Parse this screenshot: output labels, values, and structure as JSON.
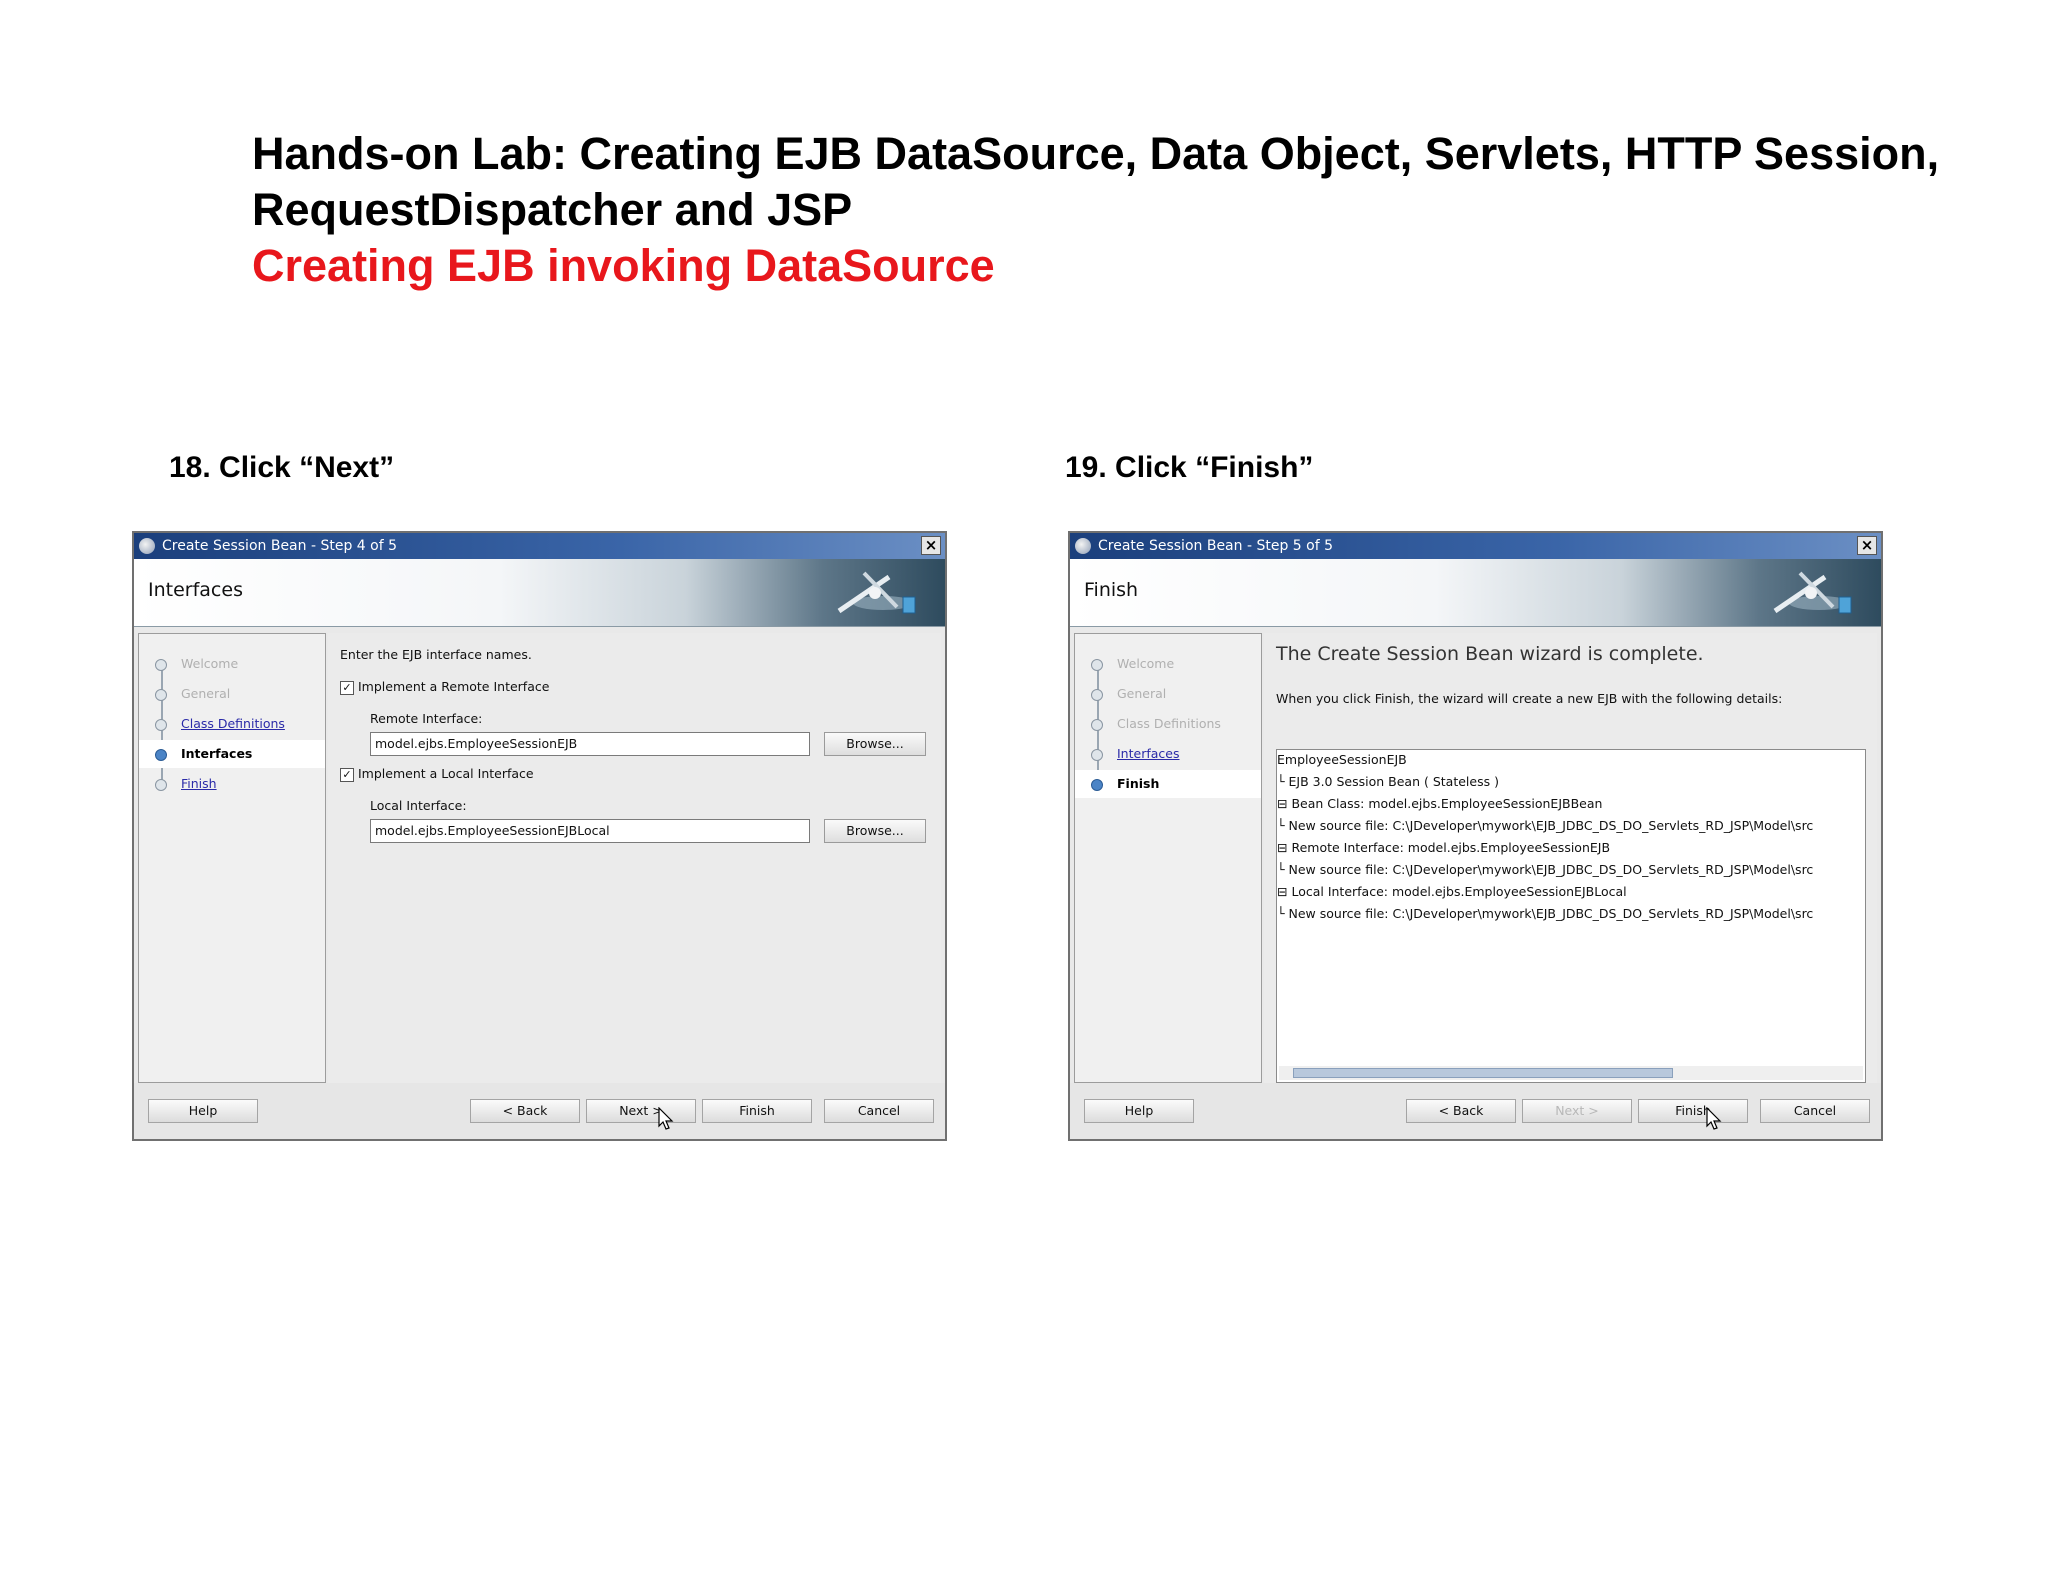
{
  "title": "Hands-on Lab: Creating EJB DataSource, Data Object, Servlets, HTTP Session, RequestDispatcher and JSP",
  "subtitle": "Creating EJB invoking DataSource",
  "steps": [
    {
      "caption": "18. Click “Next”",
      "dialog": {
        "window_title": "Create Session Bean - Step 4 of 5",
        "close_label": "×",
        "page_heading": "Interfaces",
        "nav": [
          {
            "label": "Welcome",
            "state": "disabled"
          },
          {
            "label": "General",
            "state": "disabled"
          },
          {
            "label": "Class Definitions",
            "state": "link"
          },
          {
            "label": "Interfaces",
            "state": "current"
          },
          {
            "label": "Finish",
            "state": "link"
          }
        ],
        "instruction": "Enter the EJB interface names.",
        "remote_checkbox_label": "Implement a Remote Interface",
        "remote_field_label": "Remote Interface:",
        "remote_field_value": "model.ejbs.EmployeeSessionEJB",
        "local_checkbox_label": "Implement a Local Interface",
        "local_field_label": "Local Interface:",
        "local_field_value": "model.ejbs.EmployeeSessionEJBLocal",
        "browse_label": "Browse...",
        "buttons": {
          "help": "Help",
          "back": "< Back",
          "next": "Next >",
          "finish": "Finish",
          "cancel": "Cancel"
        }
      }
    },
    {
      "caption": "19. Click “Finish”",
      "dialog": {
        "window_title": "Create Session Bean - Step 5 of 5",
        "close_label": "×",
        "page_heading": "Finish",
        "nav": [
          {
            "label": "Welcome",
            "state": "disabled"
          },
          {
            "label": "General",
            "state": "disabled"
          },
          {
            "label": "Class Definitions",
            "state": "disabled"
          },
          {
            "label": "Interfaces",
            "state": "link"
          },
          {
            "label": "Finish",
            "state": "current"
          }
        ],
        "complete_heading": "The Create Session Bean wizard is complete.",
        "complete_text": "When you click Finish, the wizard will create a new EJB with the following details:",
        "tree": [
          "EmployeeSessionEJB",
          "  └ EJB 3.0 Session Bean ( Stateless )",
          "⊟ Bean Class:  model.ejbs.EmployeeSessionEJBBean",
          "      └ New source file:  C:\\JDeveloper\\mywork\\EJB_JDBC_DS_DO_Servlets_RD_JSP\\Model\\src",
          "⊟ Remote Interface:  model.ejbs.EmployeeSessionEJB",
          "      └ New source file:  C:\\JDeveloper\\mywork\\EJB_JDBC_DS_DO_Servlets_RD_JSP\\Model\\src",
          "⊟ Local Interface:  model.ejbs.EmployeeSessionEJBLocal",
          "      └ New source file:  C:\\JDeveloper\\mywork\\EJB_JDBC_DS_DO_Servlets_RD_JSP\\Model\\src"
        ],
        "buttons": {
          "help": "Help",
          "back": "< Back",
          "next": "Next >",
          "finish": "Finish",
          "cancel": "Cancel"
        }
      }
    }
  ],
  "colors": {
    "subtitle": "#e8171c",
    "titlebar": "#1b3f7c",
    "link": "#2a2aa8"
  }
}
